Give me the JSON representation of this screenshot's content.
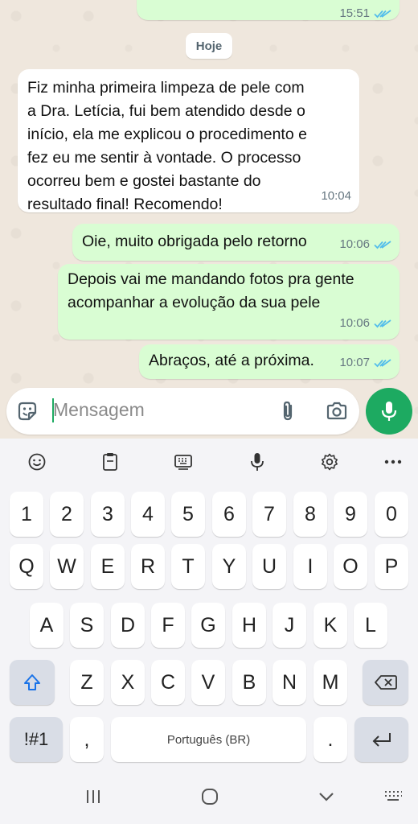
{
  "chat": {
    "prev_message": {
      "time": "15:51"
    },
    "date_chip": "Hoje",
    "messages": [
      {
        "dir": "in",
        "lines": [
          "Fiz minha primeira limpeza de pele com",
          "a Dra. Letícia, fui bem atendido desde o",
          "início, ela me explicou o procedimento e",
          "fez eu me sentir à vontade. O processo",
          "ocorreu bem e gostei bastante do",
          "resultado final! Recomendo!"
        ],
        "time": "10:04"
      },
      {
        "dir": "out",
        "lines": [
          "Oie, muito obrigada pelo retorno"
        ],
        "time": "10:06",
        "read": true
      },
      {
        "dir": "out",
        "lines": [
          "Depois vai me mandando fotos pra gente",
          "acompanhar a evolução da sua pele"
        ],
        "time": "10:06",
        "read": true
      },
      {
        "dir": "out",
        "lines": [
          "Abraços, até a próxima."
        ],
        "time": "10:07",
        "read": true
      }
    ]
  },
  "input": {
    "placeholder": "Mensagem",
    "icons": {
      "left": "sticker-icon",
      "attach": "paperclip-icon",
      "camera": "camera-icon",
      "send": "mic-icon"
    }
  },
  "keyboard": {
    "toolbar": [
      "emoji-icon",
      "clipboard-icon",
      "keyboard-icon",
      "mic-icon",
      "settings-icon",
      "more-icon"
    ],
    "row_numbers": [
      "1",
      "2",
      "3",
      "4",
      "5",
      "6",
      "7",
      "8",
      "9",
      "0"
    ],
    "row_1": [
      "Q",
      "W",
      "E",
      "R",
      "T",
      "Y",
      "U",
      "I",
      "O",
      "P"
    ],
    "row_2": [
      "A",
      "S",
      "D",
      "F",
      "G",
      "H",
      "J",
      "K",
      "L"
    ],
    "row_3": [
      "Z",
      "X",
      "C",
      "V",
      "B",
      "N",
      "M"
    ],
    "symbols_key": "!#1",
    "comma_key": ",",
    "space_label": "Português (BR)",
    "period_key": ".",
    "colors": {
      "accent": "#1daa61",
      "bubble_out": "#d9fdd3",
      "tick": "#53bdeb"
    }
  },
  "navbar": [
    "recent-apps-icon",
    "home-icon",
    "back-icon",
    "keyboard-switch-icon"
  ]
}
